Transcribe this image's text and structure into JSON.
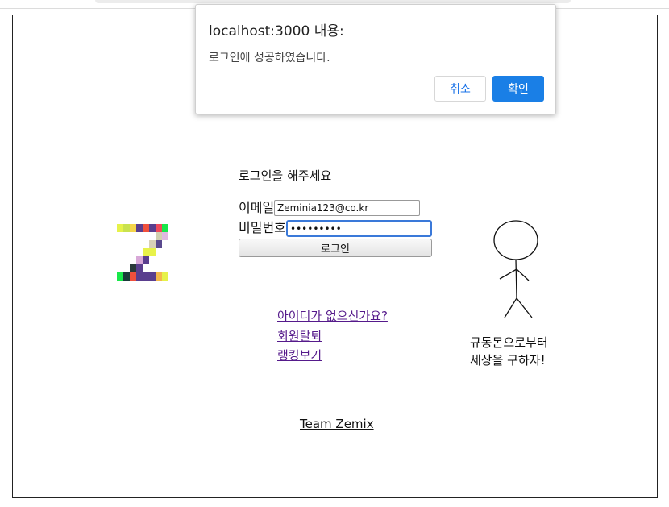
{
  "dialog": {
    "title": "localhost:3000 내용:",
    "message": "로그인에 성공하였습니다.",
    "cancel_label": "취소",
    "ok_label": "확인"
  },
  "login": {
    "heading": "로그인을 해주세요",
    "email_label": "이메일",
    "email_value": "Zeminia123@co.kr",
    "password_label": "비밀번호",
    "password_value": "•••••••••",
    "submit_label": "로그인"
  },
  "links": {
    "signup": "아이디가 없으신가요?",
    "withdraw": "회원탈퇴",
    "ranking": "랭킹보기"
  },
  "slogan": {
    "line1": "규동몬으로부터",
    "line2": "세상을 구하자!"
  },
  "footer": {
    "team": "Team Zemix"
  },
  "colors": {
    "link_visited": "#551a8b",
    "focus_border": "#3a79d9",
    "dialog_ok_bg": "#1a7fe6",
    "dialog_cancel_text": "#1a73e8"
  }
}
